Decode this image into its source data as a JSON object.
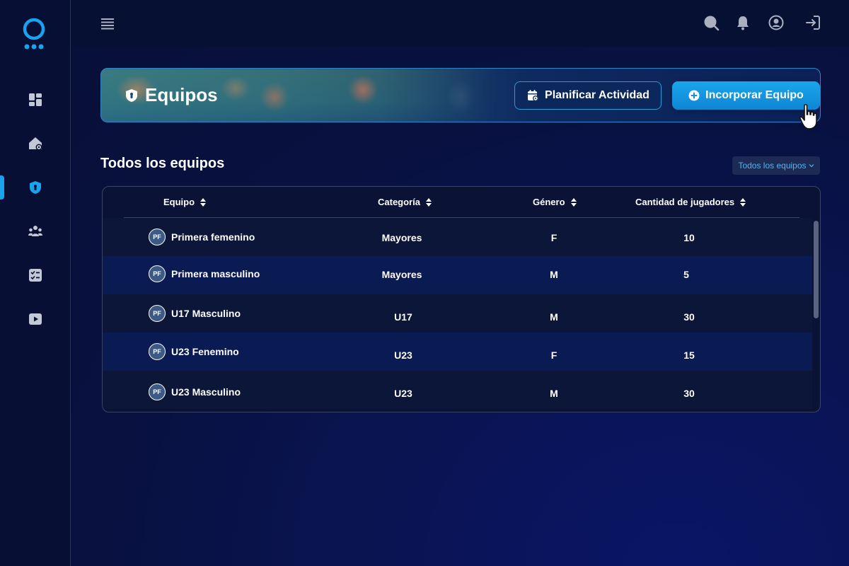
{
  "sidebar": {
    "items": [
      {
        "icon": "dashboard-icon"
      },
      {
        "icon": "home-settings-icon"
      },
      {
        "icon": "shield-icon"
      },
      {
        "icon": "team-icon"
      },
      {
        "icon": "checklist-icon"
      },
      {
        "icon": "video-icon"
      }
    ],
    "active_index": 2,
    "accent": "#19a3ee"
  },
  "header": {
    "title": "Equipos",
    "plan_button": "Planificar Actividad",
    "add_button": "Incorporar Equipo"
  },
  "section": {
    "title": "Todos los equipos",
    "filter_label": "Todos los equipos"
  },
  "table": {
    "columns": [
      "Equipo",
      "Categoría",
      "Género",
      "Cantidad de jugadores"
    ],
    "rows": [
      {
        "avatar": "PF",
        "team": "Primera femenino",
        "category": "Mayores",
        "gender": "F",
        "players": "10"
      },
      {
        "avatar": "PF",
        "team": "Primera masculino",
        "category": "Mayores",
        "gender": "M",
        "players": "5"
      },
      {
        "avatar": "PF",
        "team": "U17 Masculino",
        "category": "U17",
        "gender": "M",
        "players": "30"
      },
      {
        "avatar": "PF",
        "team": "U23 Fenemino",
        "category": "U23",
        "gender": "F",
        "players": "15"
      },
      {
        "avatar": "PF",
        "team": "U23 Masculino",
        "category": "U23",
        "gender": "M",
        "players": "30"
      }
    ]
  }
}
